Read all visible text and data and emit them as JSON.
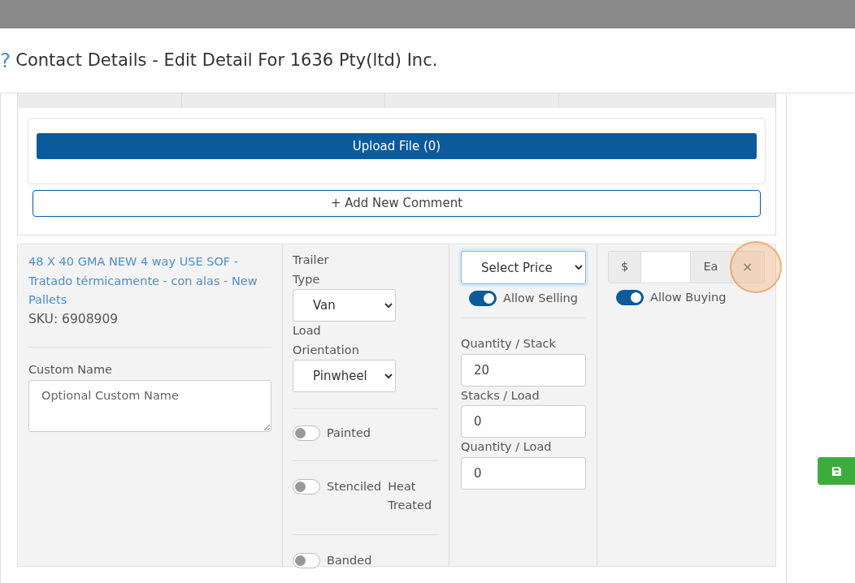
{
  "dialog": {
    "help_icon": "?",
    "title": "Contact Details - Edit Detail For 1636 Pty(ltd) Inc."
  },
  "upload_button": "Upload File (0)",
  "add_comment_button": "+ Add New Comment",
  "product": {
    "name": "48 X 40 GMA NEW 4 way USE SOF - Tratado térmicamente - con alas - New Pallets",
    "sku": "SKU: 6908909"
  },
  "custom_name": {
    "label": "Custom Name",
    "placeholder": "Optional Custom Name"
  },
  "trailer_type": {
    "label": "Trailer Type",
    "value": "Van"
  },
  "load_orientation": {
    "label": "Load Orientation",
    "value": "Pinwheel"
  },
  "options": [
    {
      "label": "Painted",
      "on": false
    },
    {
      "label": "Stenciled",
      "second_label": "Heat Treated",
      "on": false
    },
    {
      "label": "Banded",
      "on": false
    }
  ],
  "price_select": {
    "value": "Select Price"
  },
  "allow_selling": {
    "label": "Allow Selling",
    "on": true
  },
  "quantities": [
    {
      "label": "Quantity / Stack",
      "value": "20"
    },
    {
      "label": "Stacks / Load",
      "value": "0"
    },
    {
      "label": "Quantity / Load",
      "value": "0"
    }
  ],
  "price": {
    "prefix": "$",
    "suffix": "Ea",
    "remove": "×"
  },
  "allow_buying": {
    "label": "Allow Buying",
    "on": true
  }
}
